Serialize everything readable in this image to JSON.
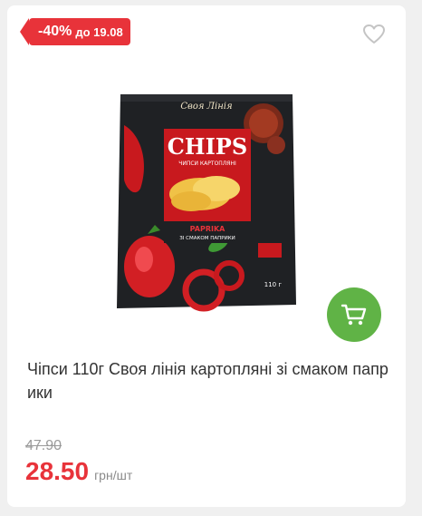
{
  "badge": {
    "discount": "-40%",
    "valid_until": "до 19.08",
    "color": "#e8333a"
  },
  "product": {
    "title": "Чіпси 110г Своя лінія картопляні зі смаком паприки",
    "image": {
      "brand": "Своя Лінія",
      "name": "CHIPS",
      "subtitle": "ЧИПСИ КАРТОПЛЯНІ",
      "flavor": "PAPRIKA",
      "flavor_sub": "ЗІ СМАКОМ ПАПРИКИ",
      "weight": "110 г"
    }
  },
  "pricing": {
    "old_price": "47.90",
    "price": "28.50",
    "unit": "грн/шт"
  },
  "icons": {
    "favorite": "heart-outline-icon",
    "cart": "cart-icon"
  },
  "colors": {
    "accent": "#e8333a",
    "cart": "#60b346"
  }
}
